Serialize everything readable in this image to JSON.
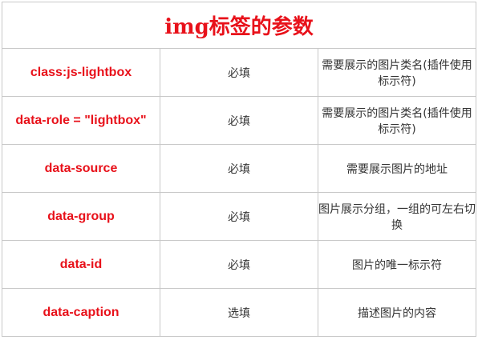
{
  "table": {
    "title": "img标签的参数",
    "rows": [
      {
        "name": "class:js-lightbox",
        "required": "必填",
        "description": "需要展示的图片类名(插件使用标示符)"
      },
      {
        "name": "data-role = \"lightbox\"",
        "required": "必填",
        "description": "需要展示的图片类名(插件使用标示符)"
      },
      {
        "name": "data-source",
        "required": "必填",
        "description": "需要展示图片的地址"
      },
      {
        "name": "data-group",
        "required": "必填",
        "description": "图片展示分组，一组的可左右切换"
      },
      {
        "name": "data-id",
        "required": "必填",
        "description": "图片的唯一标示符"
      },
      {
        "name": "data-caption",
        "required": "选填",
        "description": "描述图片的内容"
      }
    ]
  },
  "colors": {
    "accent": "#e8111a",
    "text": "#333333",
    "border": "#c8c8c8"
  }
}
